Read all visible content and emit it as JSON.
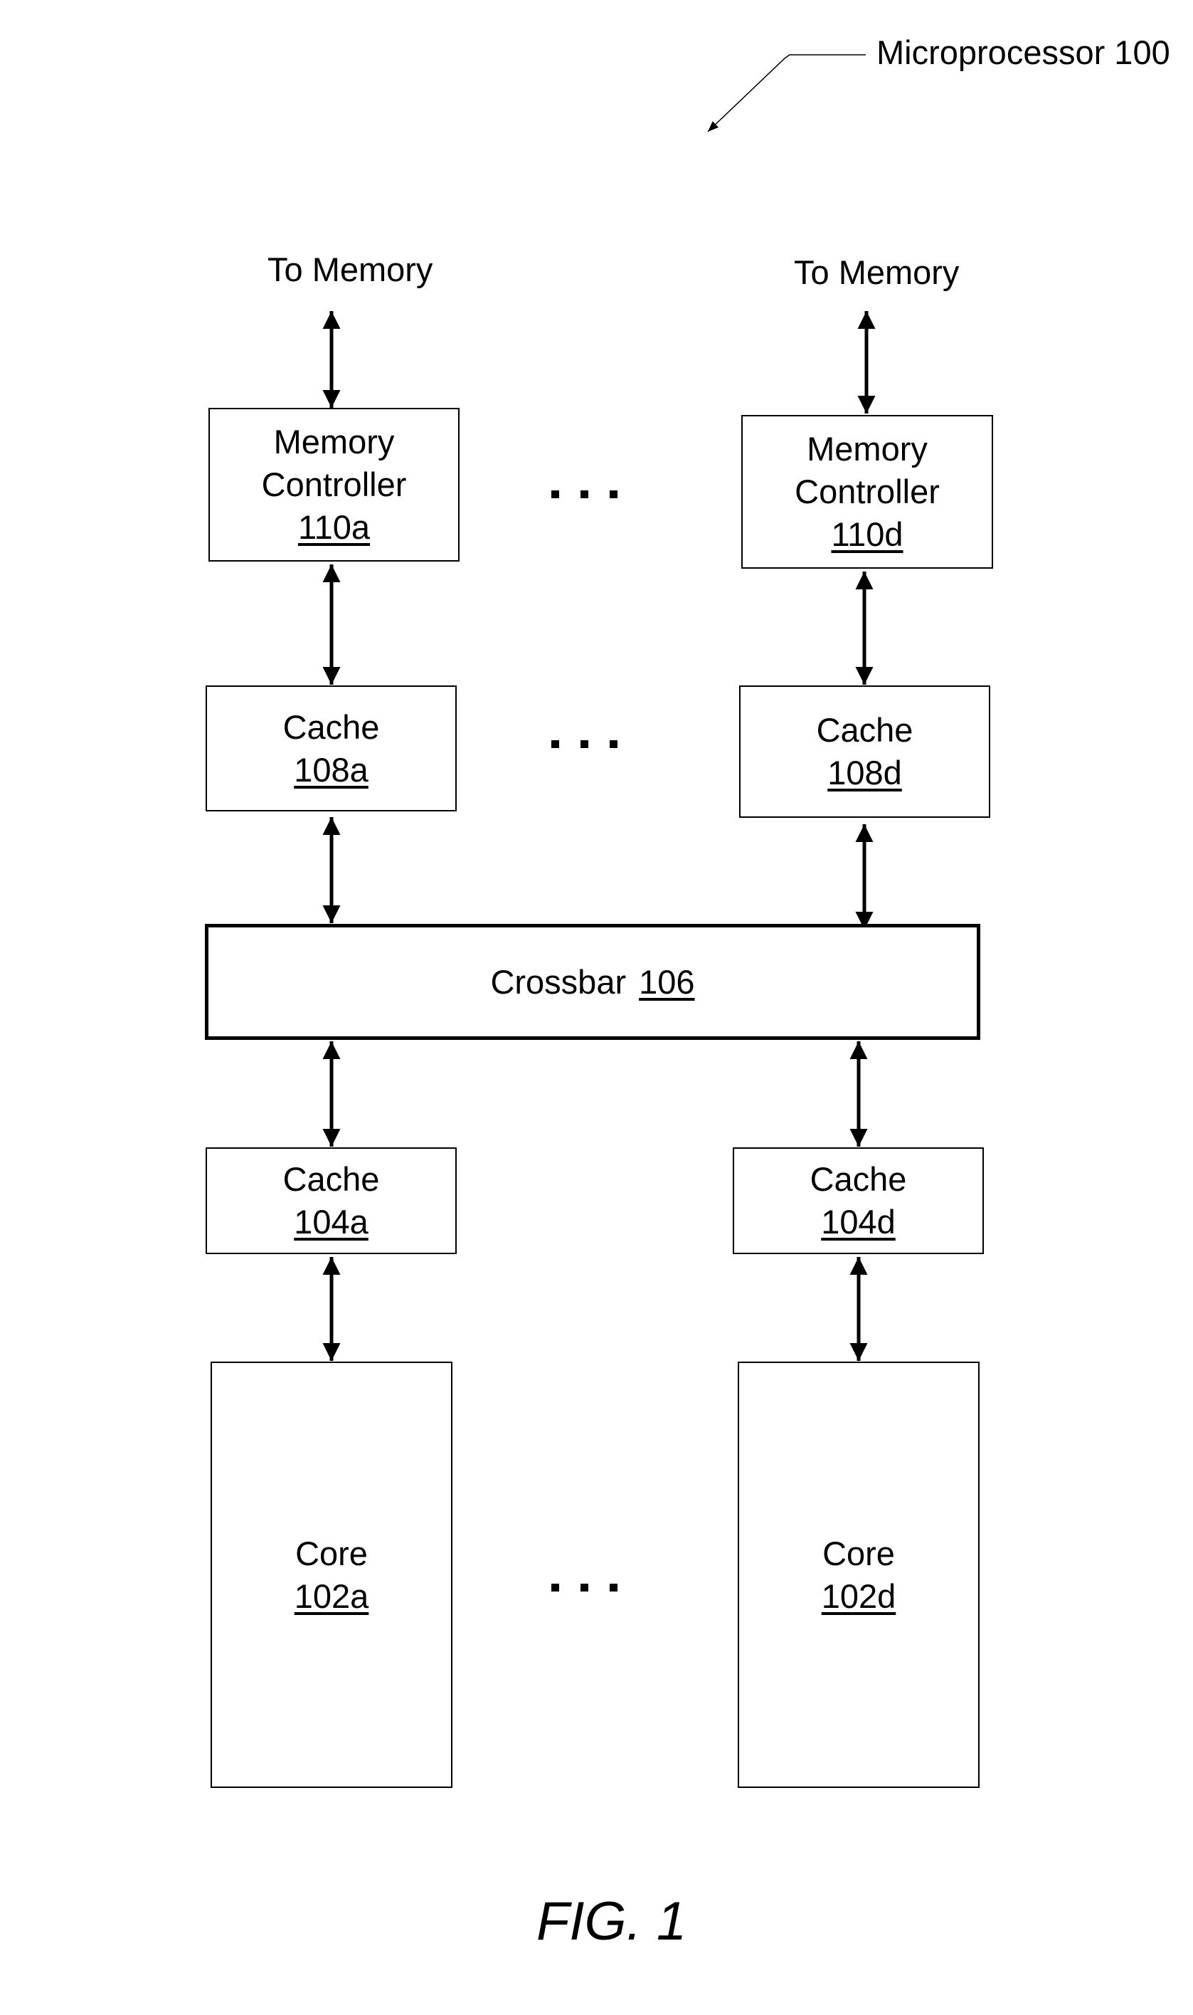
{
  "title_label": "Microprocessor 100",
  "figure_caption": "FIG. 1",
  "external": {
    "left": "To Memory",
    "right": "To Memory"
  },
  "memory_controllers": [
    {
      "name": "Memory Controller",
      "line1": "Memory",
      "line2": "Controller",
      "ref": "110a"
    },
    {
      "name": "Memory Controller",
      "line1": "Memory",
      "line2": "Controller",
      "ref": "110d"
    }
  ],
  "upper_caches": [
    {
      "name": "Cache",
      "ref": "108a"
    },
    {
      "name": "Cache",
      "ref": "108d"
    }
  ],
  "crossbar": {
    "name": "Crossbar",
    "ref": "106"
  },
  "lower_caches": [
    {
      "name": "Cache",
      "ref": "104a"
    },
    {
      "name": "Cache",
      "ref": "104d"
    }
  ],
  "cores": [
    {
      "name": "Core",
      "ref": "102a"
    },
    {
      "name": "Core",
      "ref": "102d"
    }
  ],
  "ellipsis_rows": [
    "memory-controllers",
    "upper-caches",
    "cores"
  ],
  "connections": [
    {
      "from": "memory",
      "to": "110a",
      "type": "bidirectional"
    },
    {
      "from": "memory",
      "to": "110d",
      "type": "bidirectional"
    },
    {
      "from": "110a",
      "to": "108a",
      "type": "bidirectional"
    },
    {
      "from": "110d",
      "to": "108d",
      "type": "bidirectional"
    },
    {
      "from": "108a",
      "to": "106",
      "type": "bidirectional"
    },
    {
      "from": "108d",
      "to": "106",
      "type": "bidirectional"
    },
    {
      "from": "106",
      "to": "104a",
      "type": "bidirectional"
    },
    {
      "from": "106",
      "to": "104d",
      "type": "bidirectional"
    },
    {
      "from": "104a",
      "to": "102a",
      "type": "bidirectional"
    },
    {
      "from": "104d",
      "to": "102d",
      "type": "bidirectional"
    }
  ]
}
